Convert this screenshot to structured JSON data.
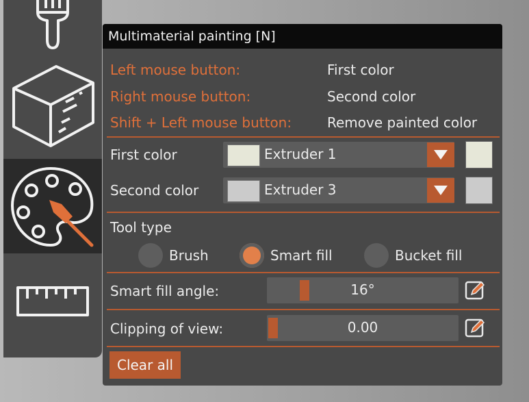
{
  "toolbar": {
    "tools": [
      {
        "icon": "paint-brush-icon"
      },
      {
        "icon": "cube-icon"
      },
      {
        "icon": "palette-icon",
        "active": true
      },
      {
        "icon": "ruler-icon"
      }
    ]
  },
  "panel": {
    "title": "Multimaterial painting [N]",
    "help": [
      {
        "key": "Left mouse button:",
        "action": "First color"
      },
      {
        "key": "Right mouse button:",
        "action": "Second color"
      },
      {
        "key": "Shift + Left mouse button:",
        "action": "Remove painted color"
      }
    ],
    "first_color": {
      "label": "First color",
      "value": "Extruder 1",
      "color": "#e6e7d8"
    },
    "second_color": {
      "label": "Second color",
      "value": "Extruder 3",
      "color": "#cbcbcb"
    },
    "tool_type": {
      "label": "Tool type",
      "options": [
        "Brush",
        "Smart fill",
        "Bucket fill"
      ],
      "selected": "Smart fill"
    },
    "smart_fill_angle": {
      "label": "Smart fill angle:",
      "value": "16°"
    },
    "clipping": {
      "label": "Clipping of view:",
      "value": "0.00"
    },
    "clear_label": "Clear all"
  },
  "colors": {
    "accent": "#b85a30",
    "accent_text": "#e0703a",
    "panel_bg": "#484848",
    "title_bg": "#0b0b0b"
  }
}
